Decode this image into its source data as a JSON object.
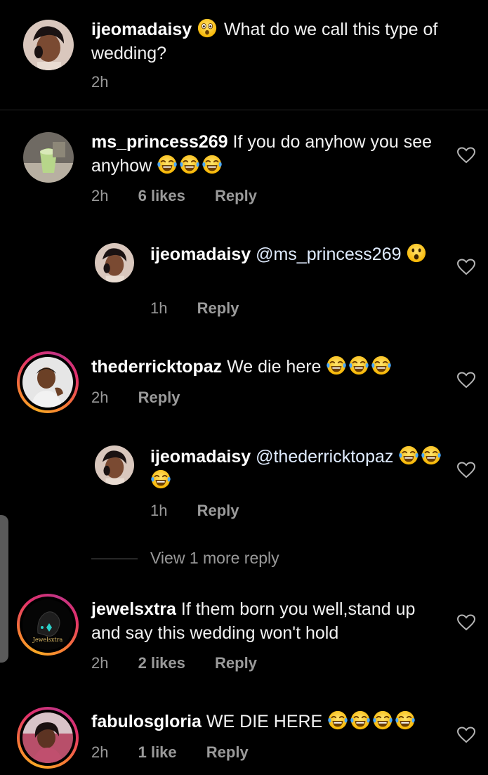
{
  "caption": {
    "username": "ijeomadaisy",
    "text": "What do we call this type of wedding?",
    "time": "2h",
    "emoji": "astonished-face"
  },
  "comments": [
    {
      "username": "ms_princess269",
      "text": "If you do anyhow you see anyhow",
      "emoji_count": 3,
      "emoji": "tears-of-joy",
      "time": "2h",
      "likes": "6 likes",
      "reply": "Reply"
    },
    {
      "username": "ijeomadaisy",
      "mention": "@ms_princess269",
      "emoji": "hushed-face",
      "time": "1h",
      "reply": "Reply"
    },
    {
      "username": "thederricktopaz",
      "text": "We die here",
      "emoji_count": 3,
      "emoji": "tears-of-joy",
      "time": "2h",
      "reply": "Reply"
    },
    {
      "username": "ijeomadaisy",
      "mention": "@thederricktopaz",
      "emoji_count": 3,
      "emoji": "tears-of-joy",
      "time": "1h",
      "reply": "Reply"
    },
    {
      "username": "jewelsxtra",
      "text": "If them born you well,stand up and say this wedding won't hold",
      "time": "2h",
      "likes": "2 likes",
      "reply": "Reply",
      "avatar_text": "Jewelsxtra"
    },
    {
      "username": "fabulosgloria",
      "text": "WE DIE HERE",
      "emoji_count": 4,
      "emoji": "tears-of-joy",
      "time": "2h",
      "likes": "1 like",
      "reply": "Reply"
    }
  ],
  "view_more": "View 1 more reply",
  "colors": {
    "background": "#000000",
    "text": "#f2f2f2",
    "meta": "#9a9a9a",
    "story_ring_start": "#f9a825",
    "story_ring_end": "#c13584"
  }
}
